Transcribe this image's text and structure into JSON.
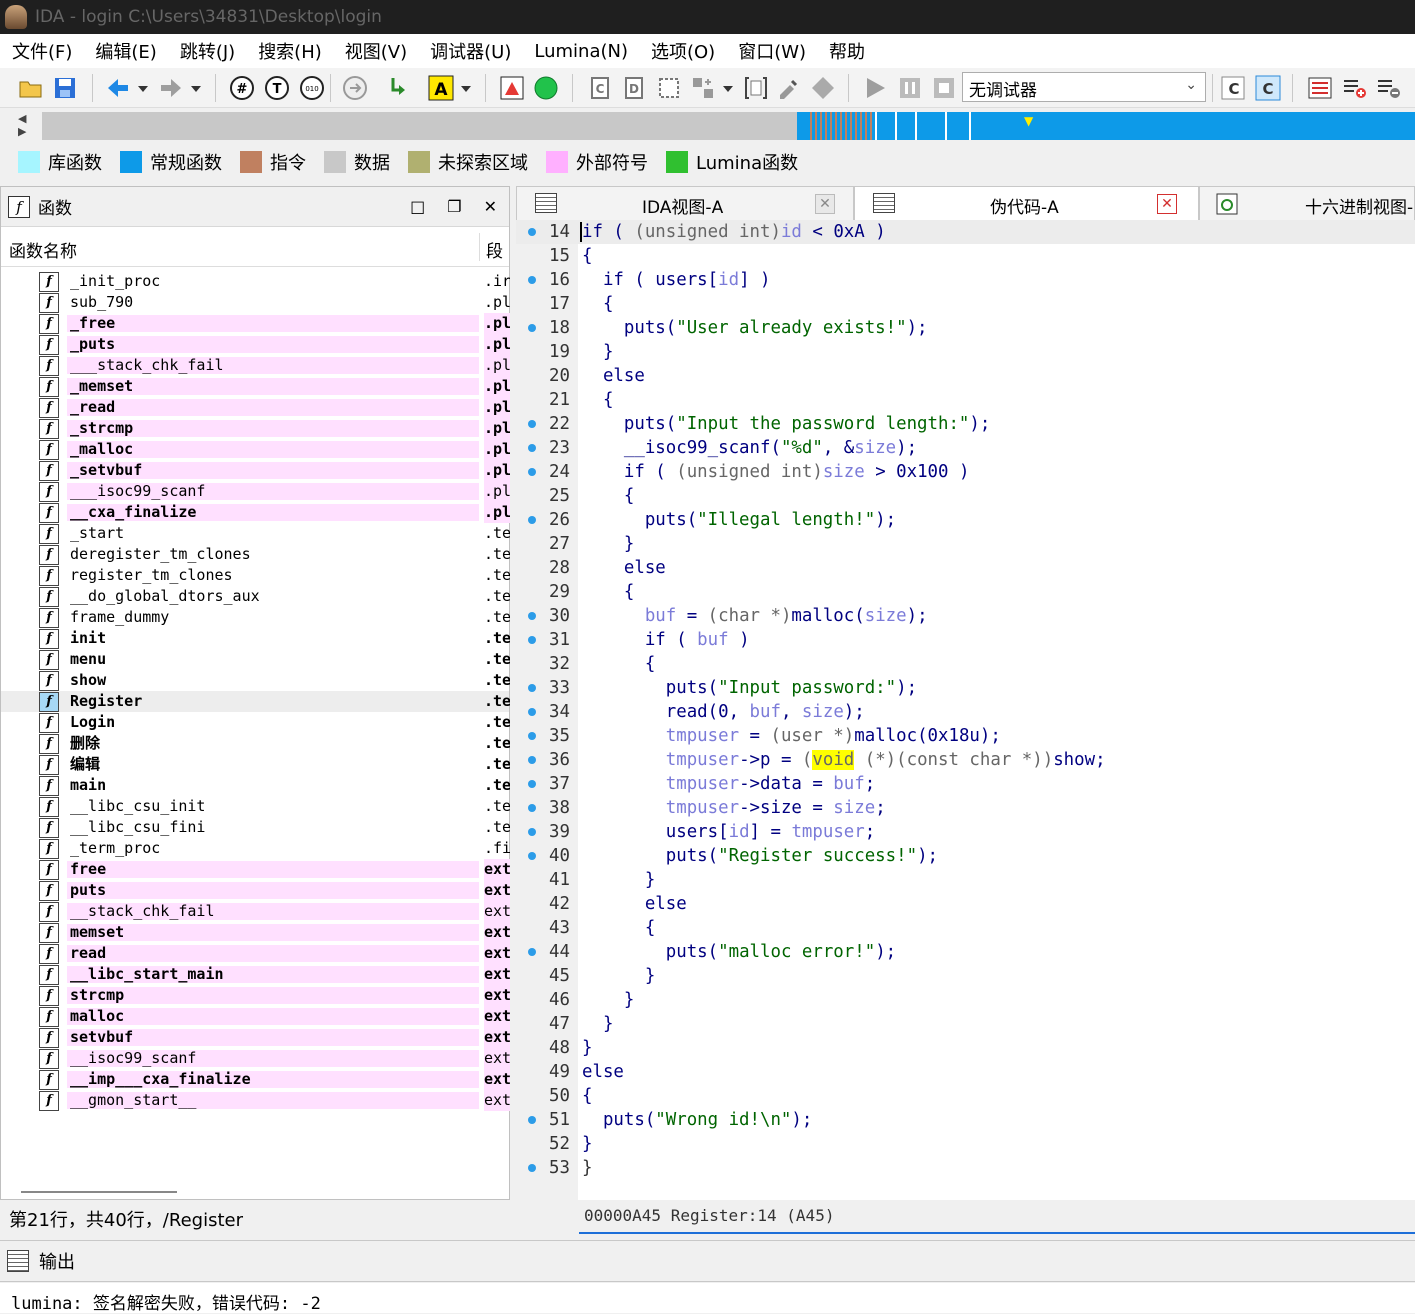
{
  "window": {
    "title": "IDA - login C:\\Users\\34831\\Desktop\\login"
  },
  "menu": [
    "文件(F)",
    "编辑(E)",
    "跳转(J)",
    "搜索(H)",
    "视图(V)",
    "调试器(U)",
    "Lumina(N)",
    "选项(O)",
    "窗口(W)",
    "帮助"
  ],
  "toolbar": {
    "debugger": "无调试器"
  },
  "legend": [
    {
      "label": "库函数",
      "color": "#a6f5ff"
    },
    {
      "label": "常规函数",
      "color": "#0d9ae8"
    },
    {
      "label": "指令",
      "color": "#c08060"
    },
    {
      "label": "数据",
      "color": "#c8c8c8"
    },
    {
      "label": "未探索区域",
      "color": "#b0b070"
    },
    {
      "label": "外部符号",
      "color": "#ffb0ff"
    },
    {
      "label": "Lumina函数",
      "color": "#30c030"
    }
  ],
  "functions_panel": {
    "title": "函数",
    "col_name": "函数名称",
    "col_seg": "段",
    "status": "第21行，共40行，/Register",
    "rows": [
      {
        "name": "_init_proc",
        "seg": ".ir",
        "style": ""
      },
      {
        "name": "sub_790",
        "seg": ".pl",
        "style": ""
      },
      {
        "name": "_free",
        "seg": ".pl",
        "style": "pink bold"
      },
      {
        "name": "_puts",
        "seg": ".pl",
        "style": "pink bold"
      },
      {
        "name": "___stack_chk_fail",
        "seg": ".pl",
        "style": "pink"
      },
      {
        "name": "_memset",
        "seg": ".pl",
        "style": "pink bold"
      },
      {
        "name": "_read",
        "seg": ".pl",
        "style": "pink bold"
      },
      {
        "name": "_strcmp",
        "seg": ".pl",
        "style": "pink bold"
      },
      {
        "name": "_malloc",
        "seg": ".pl",
        "style": "pink bold"
      },
      {
        "name": "_setvbuf",
        "seg": ".pl",
        "style": "pink bold"
      },
      {
        "name": "___isoc99_scanf",
        "seg": ".pl",
        "style": "pink"
      },
      {
        "name": "__cxa_finalize",
        "seg": ".pl",
        "style": "pink bold"
      },
      {
        "name": "_start",
        "seg": ".te",
        "style": ""
      },
      {
        "name": "deregister_tm_clones",
        "seg": ".te",
        "style": ""
      },
      {
        "name": "register_tm_clones",
        "seg": ".te",
        "style": ""
      },
      {
        "name": "__do_global_dtors_aux",
        "seg": ".te",
        "style": ""
      },
      {
        "name": "frame_dummy",
        "seg": ".te",
        "style": ""
      },
      {
        "name": "init",
        "seg": ".te",
        "style": "bold"
      },
      {
        "name": "menu",
        "seg": ".te",
        "style": "bold"
      },
      {
        "name": "show",
        "seg": ".te",
        "style": "bold"
      },
      {
        "name": "Register",
        "seg": ".te",
        "style": "bold sel"
      },
      {
        "name": "Login",
        "seg": ".te",
        "style": "bold"
      },
      {
        "name": "删除",
        "seg": ".te",
        "style": "bold"
      },
      {
        "name": "编辑",
        "seg": ".te",
        "style": "bold"
      },
      {
        "name": "main",
        "seg": ".te",
        "style": "bold"
      },
      {
        "name": "__libc_csu_init",
        "seg": ".te",
        "style": ""
      },
      {
        "name": "__libc_csu_fini",
        "seg": ".te",
        "style": ""
      },
      {
        "name": "_term_proc",
        "seg": ".fi",
        "style": ""
      },
      {
        "name": "free",
        "seg": "ext",
        "style": "pink bold"
      },
      {
        "name": "puts",
        "seg": "ext",
        "style": "pink bold"
      },
      {
        "name": "__stack_chk_fail",
        "seg": "ext",
        "style": "pink"
      },
      {
        "name": "memset",
        "seg": "ext",
        "style": "pink bold"
      },
      {
        "name": "read",
        "seg": "ext",
        "style": "pink bold"
      },
      {
        "name": "__libc_start_main",
        "seg": "ext",
        "style": "pink bold"
      },
      {
        "name": "strcmp",
        "seg": "ext",
        "style": "pink bold"
      },
      {
        "name": "malloc",
        "seg": "ext",
        "style": "pink bold"
      },
      {
        "name": "setvbuf",
        "seg": "ext",
        "style": "pink bold"
      },
      {
        "name": "__isoc99_scanf",
        "seg": "ext",
        "style": "pink"
      },
      {
        "name": "__imp___cxa_finalize",
        "seg": "ext",
        "style": "pink bold"
      },
      {
        "name": "__gmon_start__",
        "seg": "ext",
        "style": "pink"
      }
    ]
  },
  "tabs": [
    {
      "label": "IDA视图-A",
      "active": false
    },
    {
      "label": "伪代码-A",
      "active": true
    },
    {
      "label": "十六进制视图-",
      "active": false
    }
  ],
  "code": {
    "lines": [
      {
        "n": "14",
        "dot": true,
        "cur": true,
        "html": "<span class=\"k\">if ( </span><span class=\"t\">(unsigned int)</span><span class=\"v\">id</span><span class=\"k\"> &lt; 0xA )</span>"
      },
      {
        "n": "15",
        "dot": false,
        "html": "<span class=\"k\">{</span>"
      },
      {
        "n": "16",
        "dot": true,
        "html": "<span class=\"k\">  if ( users[</span><span class=\"v\">id</span><span class=\"k\">] )</span>"
      },
      {
        "n": "17",
        "dot": false,
        "html": "<span class=\"k\">  {</span>"
      },
      {
        "n": "18",
        "dot": true,
        "html": "<span class=\"k\">    puts(</span><span class=\"s\">\"User already exists!\"</span><span class=\"k\">);</span>"
      },
      {
        "n": "19",
        "dot": false,
        "html": "<span class=\"k\">  }</span>"
      },
      {
        "n": "20",
        "dot": false,
        "html": "<span class=\"k\">  else</span>"
      },
      {
        "n": "21",
        "dot": false,
        "html": "<span class=\"k\">  {</span>"
      },
      {
        "n": "22",
        "dot": true,
        "html": "<span class=\"k\">    puts(</span><span class=\"s\">\"Input the password length:\"</span><span class=\"k\">);</span>"
      },
      {
        "n": "23",
        "dot": true,
        "html": "<span class=\"k\">    __isoc99_scanf(</span><span class=\"s\">\"%d\"</span><span class=\"k\">, &amp;</span><span class=\"v\">size</span><span class=\"k\">);</span>"
      },
      {
        "n": "24",
        "dot": true,
        "html": "<span class=\"k\">    if ( </span><span class=\"t\">(unsigned int)</span><span class=\"v\">size</span><span class=\"k\"> &gt; 0x100 )</span>"
      },
      {
        "n": "25",
        "dot": false,
        "html": "<span class=\"k\">    {</span>"
      },
      {
        "n": "26",
        "dot": true,
        "html": "<span class=\"k\">      puts(</span><span class=\"s\">\"Illegal length!\"</span><span class=\"k\">);</span>"
      },
      {
        "n": "27",
        "dot": false,
        "html": "<span class=\"k\">    }</span>"
      },
      {
        "n": "28",
        "dot": false,
        "html": "<span class=\"k\">    else</span>"
      },
      {
        "n": "29",
        "dot": false,
        "html": "<span class=\"k\">    {</span>"
      },
      {
        "n": "30",
        "dot": true,
        "html": "<span class=\"v\">      buf</span><span class=\"k\"> = </span><span class=\"t\">(char *)</span><span class=\"k\">malloc(</span><span class=\"v\">size</span><span class=\"k\">);</span>"
      },
      {
        "n": "31",
        "dot": true,
        "html": "<span class=\"k\">      if ( </span><span class=\"v\">buf</span><span class=\"k\"> )</span>"
      },
      {
        "n": "32",
        "dot": false,
        "html": "<span class=\"k\">      {</span>"
      },
      {
        "n": "33",
        "dot": true,
        "html": "<span class=\"k\">        puts(</span><span class=\"s\">\"Input password:\"</span><span class=\"k\">);</span>"
      },
      {
        "n": "34",
        "dot": true,
        "html": "<span class=\"k\">        read(0, </span><span class=\"v\">buf</span><span class=\"k\">, </span><span class=\"v\">size</span><span class=\"k\">);</span>"
      },
      {
        "n": "35",
        "dot": true,
        "html": "<span class=\"v\">        tmpuser</span><span class=\"k\"> = </span><span class=\"t\">(user *)</span><span class=\"k\">malloc(0x18u);</span>"
      },
      {
        "n": "36",
        "dot": true,
        "html": "<span class=\"v\">        tmpuser</span><span class=\"k\">-&gt;p = </span><span class=\"t\">(</span><span class=\"t hl\">void</span><span class=\"t\"> (*)(const char *))</span><span class=\"k\">show;</span>"
      },
      {
        "n": "37",
        "dot": true,
        "html": "<span class=\"v\">        tmpuser</span><span class=\"k\">-&gt;data = </span><span class=\"v\">buf</span><span class=\"k\">;</span>"
      },
      {
        "n": "38",
        "dot": true,
        "html": "<span class=\"v\">        tmpuser</span><span class=\"k\">-&gt;size = </span><span class=\"v\">size</span><span class=\"k\">;</span>"
      },
      {
        "n": "39",
        "dot": true,
        "html": "<span class=\"k\">        users[</span><span class=\"v\">id</span><span class=\"k\">] = </span><span class=\"v\">tmpuser</span><span class=\"k\">;</span>"
      },
      {
        "n": "40",
        "dot": true,
        "html": "<span class=\"k\">        puts(</span><span class=\"s\">\"Register success!\"</span><span class=\"k\">);</span>"
      },
      {
        "n": "41",
        "dot": false,
        "html": "<span class=\"k\">      }</span>"
      },
      {
        "n": "42",
        "dot": false,
        "html": "<span class=\"k\">      else</span>"
      },
      {
        "n": "43",
        "dot": false,
        "html": "<span class=\"k\">      {</span>"
      },
      {
        "n": "44",
        "dot": true,
        "html": "<span class=\"k\">        puts(</span><span class=\"s\">\"malloc error!\"</span><span class=\"k\">);</span>"
      },
      {
        "n": "45",
        "dot": false,
        "html": "<span class=\"k\">      }</span>"
      },
      {
        "n": "46",
        "dot": false,
        "html": "<span class=\"k\">    }</span>"
      },
      {
        "n": "47",
        "dot": false,
        "html": "<span class=\"k\">  }</span>"
      },
      {
        "n": "48",
        "dot": false,
        "html": "<span class=\"k\">}</span>"
      },
      {
        "n": "49",
        "dot": false,
        "html": "<span class=\"k\">else</span>"
      },
      {
        "n": "50",
        "dot": false,
        "html": "<span class=\"k\">{</span>"
      },
      {
        "n": "51",
        "dot": true,
        "html": "<span class=\"k\">  puts(</span><span class=\"s\">\"Wrong id!\\n\"</span><span class=\"k\">);</span>"
      },
      {
        "n": "52",
        "dot": false,
        "html": "<span class=\"k\">}</span>"
      },
      {
        "n": "53",
        "dot": true,
        "html": "<span class=\"g\">}</span>"
      }
    ],
    "status": "00000A45 Register:14 (A45)"
  },
  "output": {
    "title": "输出",
    "text": "lumina: 签名解密失败，错误代码: -2"
  }
}
